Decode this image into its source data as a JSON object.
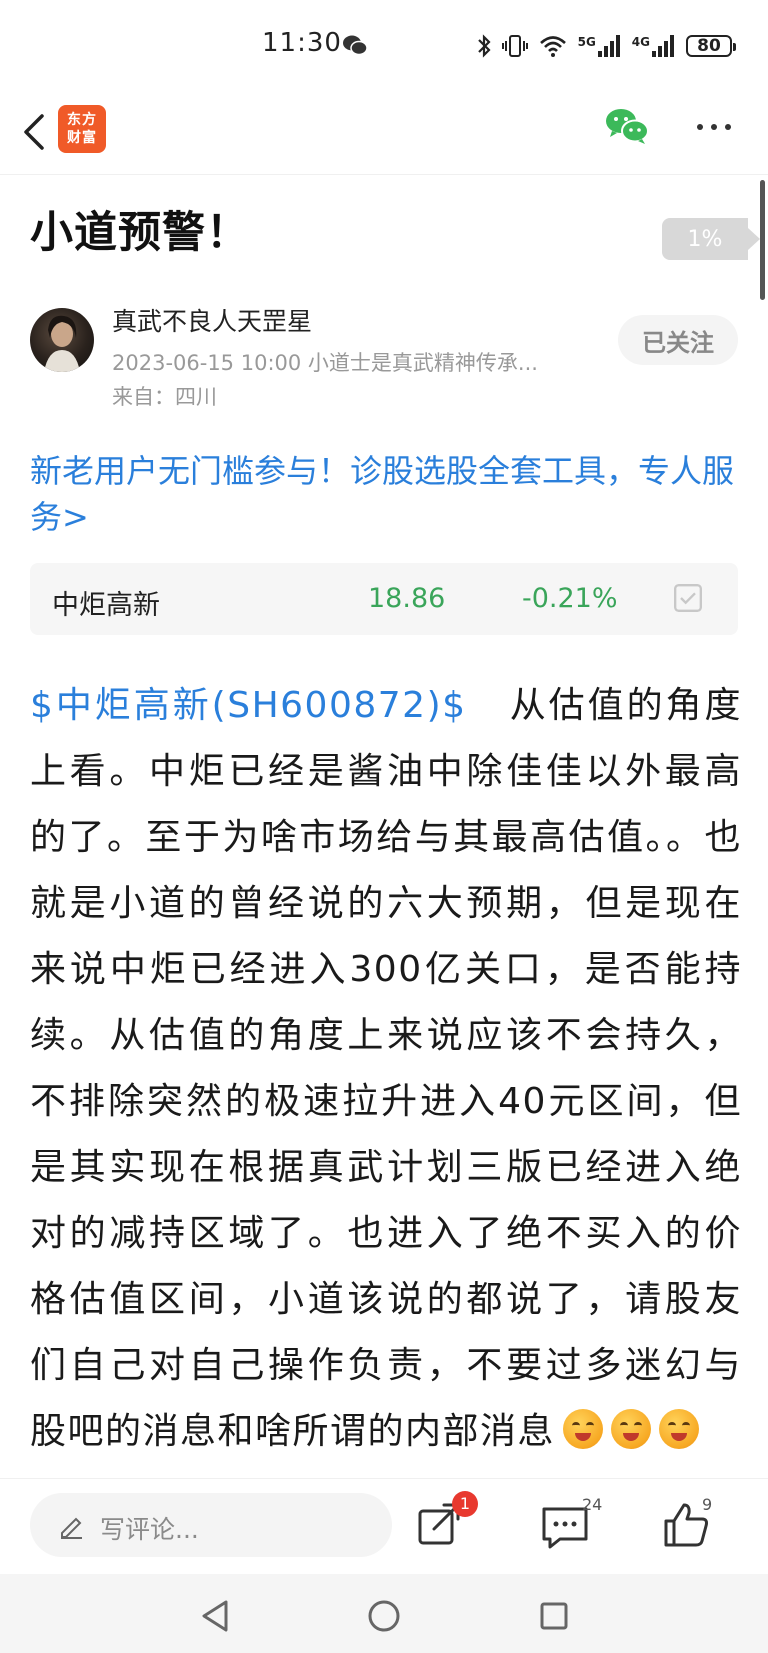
{
  "status_bar": {
    "time": "11:30",
    "network_labels": [
      "5G",
      "4G"
    ],
    "battery": "80",
    "icons": [
      "wechat-notification-icon",
      "bluetooth-icon",
      "vibrate-icon",
      "wifi-icon",
      "signal-icon",
      "signal-icon",
      "battery-icon"
    ]
  },
  "nav": {
    "logo_line1": "东方",
    "logo_line2": "财富",
    "logo_color": "#f05a28",
    "icons": [
      "back-arrow-icon",
      "wechat-share-icon",
      "more-dots-icon"
    ]
  },
  "article": {
    "title": "小道预警！",
    "read_progress": "1%",
    "author": {
      "name": "真武不良人天罡星",
      "meta": "2023-06-15 10:00 小道士是真武精神传承...",
      "location": "来自：四川",
      "follow_label": "已关注"
    },
    "promo_link": "新老用户无门槛参与！诊股选股全套工具，专人服务>",
    "stock_card": {
      "name": "中炬高新",
      "price": "18.86",
      "change": "-0.21%",
      "price_color": "#3aa55a"
    },
    "body": {
      "stock_tag": "$中炬高新(SH600872)$",
      "text": "从估值的角度上看。中炬已经是酱油中除佳佳以外最高的了。至于为啥市场给与其最高估值。。也就是小道的曾经说的六大预期，但是现在来说中炬已经进入300亿关口，是否能持续。从估值的角度上来说应该不会持久，不排除突然的极速拉升进入40元区间，但是其实现在根据真武计划三版已经进入绝对的减持区域了。也进入了绝不买入的价格估值区间，小道该说的都说了，请股友们自己对自己操作负责，不要过多迷幻与股吧的消息和啥所谓的内部消息",
      "emoji_count": 3
    }
  },
  "action_bar": {
    "comment_placeholder": "写评论...",
    "share_badge": "1",
    "comments_count": "24",
    "likes_count": "9",
    "accent_color": "#2a7fdb",
    "badge_color": "#e8392f"
  },
  "system_nav": {
    "icons": [
      "back-triangle-icon",
      "home-circle-icon",
      "recents-square-icon"
    ]
  }
}
